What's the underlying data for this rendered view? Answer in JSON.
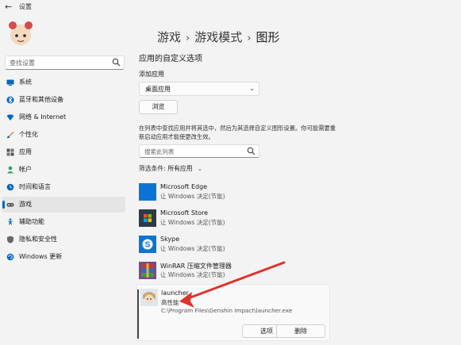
{
  "window": {
    "title": "设置",
    "back_glyph": "←"
  },
  "sidebar": {
    "search_placeholder": "查找设置",
    "items": [
      {
        "label": "系统",
        "icon": "monitor-icon",
        "color": "#0067c0"
      },
      {
        "label": "蓝牙和其他设备",
        "icon": "bluetooth-icon",
        "color": "#0067c0"
      },
      {
        "label": "网络 & Internet",
        "icon": "wifi-icon",
        "color": "#0067c0"
      },
      {
        "label": "个性化",
        "icon": "brush-icon",
        "color": "#e08a2e"
      },
      {
        "label": "应用",
        "icon": "apps-icon",
        "color": "#555555"
      },
      {
        "label": "帐户",
        "icon": "person-icon",
        "color": "#2aa260"
      },
      {
        "label": "时间和语言",
        "icon": "clock-globe-icon",
        "color": "#0067c0"
      },
      {
        "label": "游戏",
        "icon": "gamepad-icon",
        "color": "#555555",
        "active": true
      },
      {
        "label": "辅助功能",
        "icon": "accessibility-icon",
        "color": "#0067c0"
      },
      {
        "label": "隐私和安全性",
        "icon": "shield-icon",
        "color": "#555555"
      },
      {
        "label": "Windows 更新",
        "icon": "update-icon",
        "color": "#0067c0"
      }
    ]
  },
  "breadcrumb": {
    "part1": "游戏",
    "sep": "›",
    "part2": "游戏模式",
    "part3": "图形"
  },
  "main": {
    "section_title": "应用的自定义选项",
    "add_app_label": "添加应用",
    "dropdown_value": "桌面应用",
    "browse_label": "浏览",
    "info_text": "在列表中查找应用并将其选中，然后为其选择自定义图形设置。你可能需要重新启动应用才能使更改生效。",
    "list_search_placeholder": "搜索此列表",
    "filter_label": "筛选条件:",
    "filter_value": "所有应用",
    "apps": [
      {
        "name": "Microsoft Edge",
        "sub": "让 Windows 决定(节能)",
        "icon": "edge-icon"
      },
      {
        "name": "Microsoft Store",
        "sub": "让 Windows 决定(节能)",
        "icon": "store-icon"
      },
      {
        "name": "Skype",
        "sub": "让 Windows 决定(节能)",
        "icon": "skype-icon"
      },
      {
        "name": "WinRAR 压缩文件管理器",
        "sub": "让 Windows 决定(节能)",
        "icon": "winrar-icon"
      }
    ],
    "expanded_app": {
      "name": "launcher",
      "sub": "高性能",
      "path": "C:\\Program Files\\Genshin Impact\\launcher.exe",
      "options_label": "选项",
      "delete_label": "删除"
    }
  },
  "annotation": {
    "arrow_color": "#e0322b"
  }
}
